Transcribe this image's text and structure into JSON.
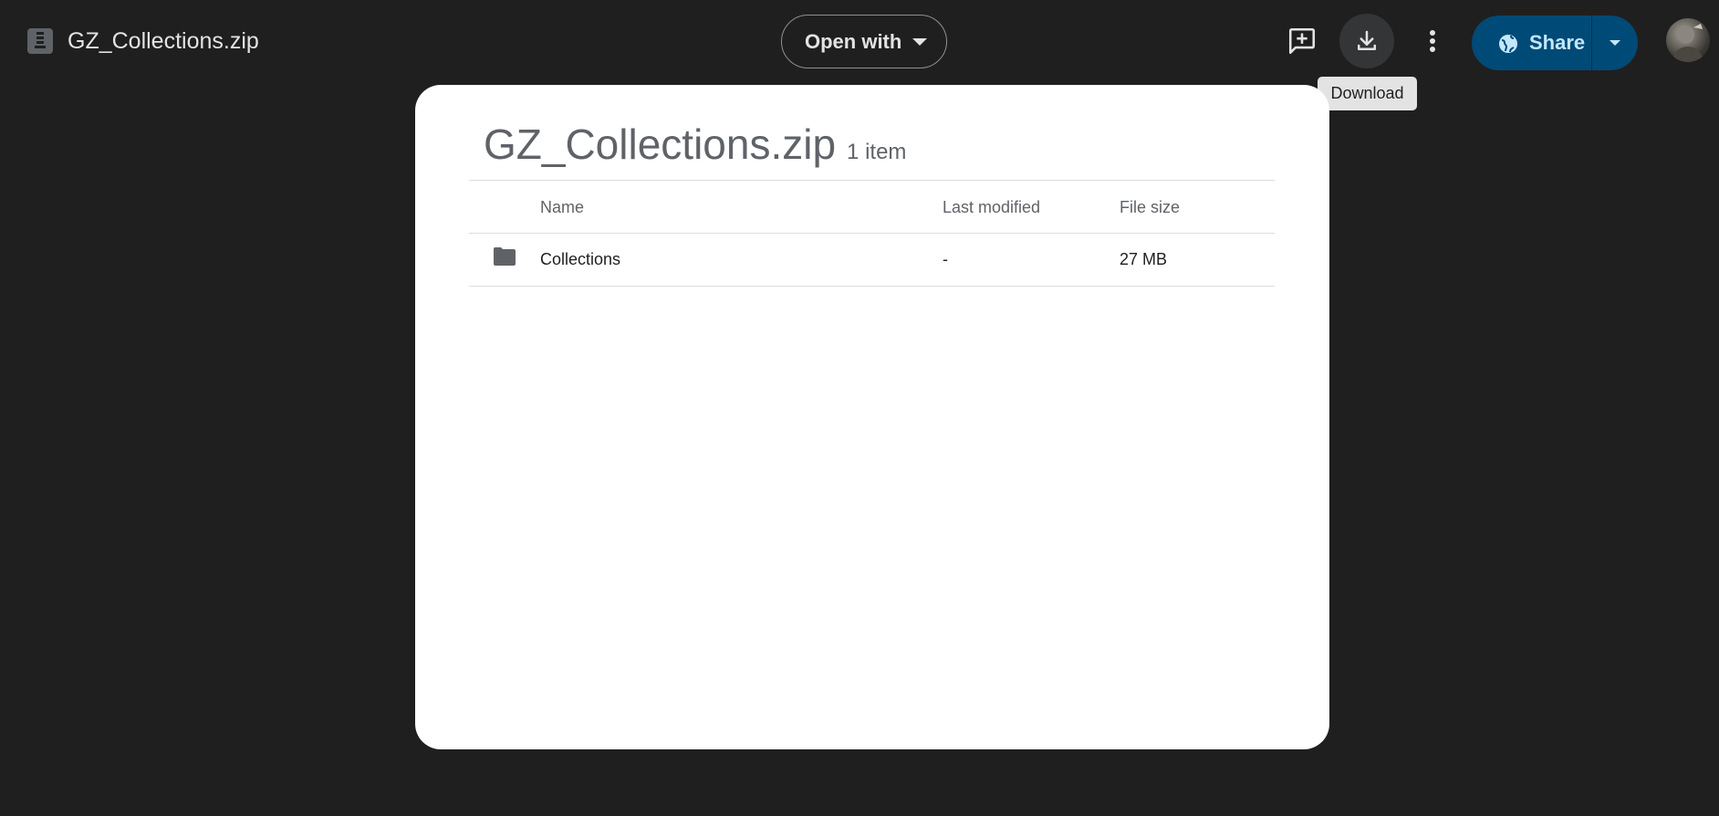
{
  "header": {
    "file_name": "GZ_Collections.zip",
    "open_with_label": "Open with",
    "tooltip": "Download",
    "share_label": "Share",
    "icons": [
      "file-icon",
      "add-comment-icon",
      "download-icon",
      "more-vert-icon",
      "globe-icon",
      "caret-down-icon"
    ]
  },
  "card": {
    "title": "GZ_Collections.zip",
    "item_count": "1 item",
    "columns": [
      "Name",
      "Last modified",
      "File size"
    ],
    "rows": [
      {
        "icon": "folder-icon",
        "name": "Collections",
        "last_modified": "-",
        "file_size": "27 MB"
      }
    ]
  },
  "colors": {
    "background": "#1f1f1f",
    "share_button": "#004a77",
    "share_text": "#c2e7ff",
    "card": "#ffffff",
    "tooltip": "#e3e3e3"
  }
}
